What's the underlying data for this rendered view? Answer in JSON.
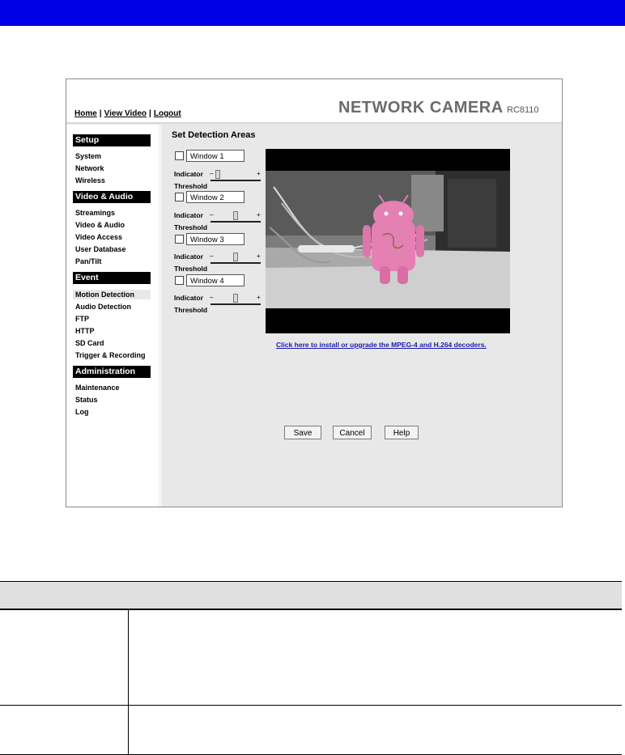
{
  "header_links": {
    "home": "Home",
    "view_video": "View Video",
    "logout": "Logout",
    "separator": "|"
  },
  "brand": {
    "title": "NETWORK CAMERA",
    "model": "RC8110"
  },
  "sidebar": {
    "setup": {
      "title": "Setup",
      "items": [
        "System",
        "Network",
        "Wireless"
      ]
    },
    "video_audio": {
      "title": "Video & Audio",
      "items": [
        "Streamings",
        "Video & Audio",
        "Video Access",
        "User Database",
        "Pan/Tilt"
      ]
    },
    "event": {
      "title": "Event",
      "items": [
        "Motion Detection",
        "Audio Detection",
        "FTP",
        "HTTP",
        "SD Card",
        "Trigger & Recording"
      ]
    },
    "administration": {
      "title": "Administration",
      "items": [
        "Maintenance",
        "Status",
        "Log"
      ]
    },
    "active_item": "Motion Detection"
  },
  "main": {
    "title": "Set Detection Areas",
    "indicator_label": "Indicator",
    "threshold_label": "Threshold",
    "windows": [
      {
        "name": "Window 1",
        "checked": false,
        "threshold": 0.1
      },
      {
        "name": "Window 2",
        "checked": false,
        "threshold": 0.5
      },
      {
        "name": "Window 3",
        "checked": false,
        "threshold": 0.5
      },
      {
        "name": "Window 4",
        "checked": false,
        "threshold": 0.5
      }
    ],
    "decoder_link": "Click here to install or upgrade the MPEG-4 and H.264 decoders."
  },
  "buttons": {
    "save": "Save",
    "cancel": "Cancel",
    "help": "Help"
  },
  "colors": {
    "top_bar": "#0000e6",
    "link": "#1a1ab0"
  }
}
